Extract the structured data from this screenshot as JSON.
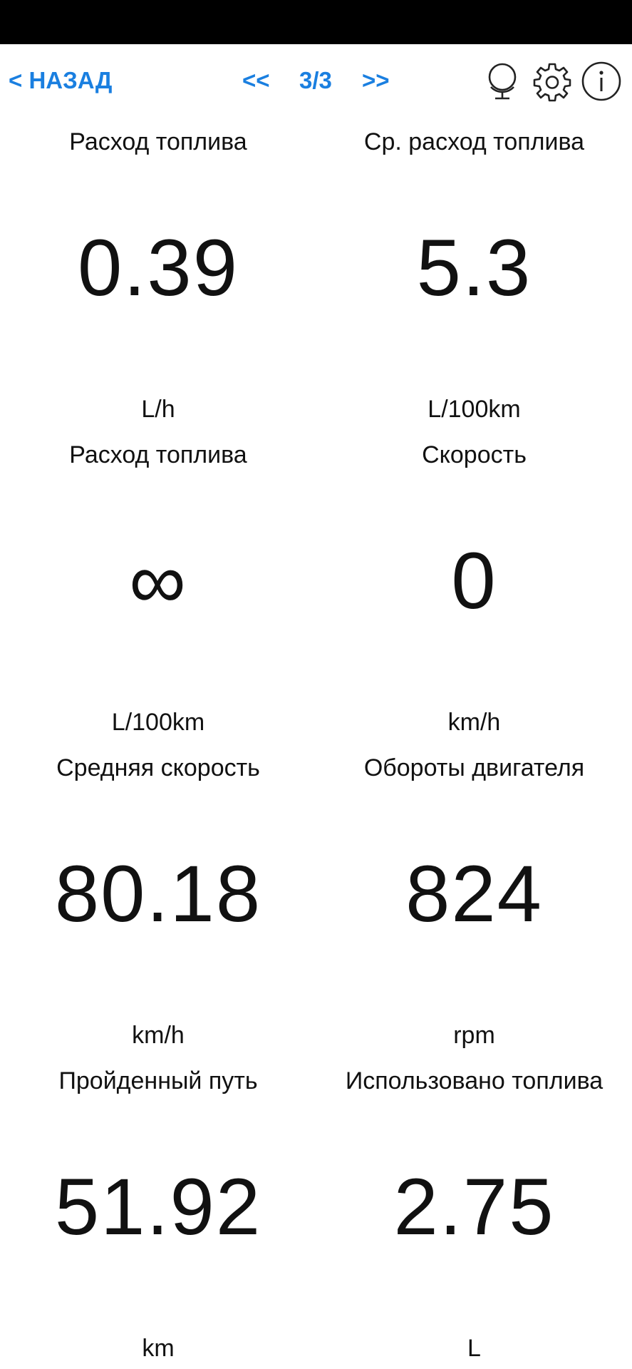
{
  "header": {
    "back_label": "< НАЗАД",
    "prev_label": "<<",
    "page_indicator": "3/3",
    "next_label": ">>",
    "icons": [
      "globe-icon",
      "gear-icon",
      "info-icon"
    ],
    "accent_color": "#1a7fe0"
  },
  "metrics": [
    {
      "label": "Расход топлива",
      "value": "0.39",
      "unit": "L/h"
    },
    {
      "label": "Ср. расход топлива",
      "value": "5.3",
      "unit": "L/100km"
    },
    {
      "label": "Расход топлива",
      "value": "∞",
      "unit": "L/100km"
    },
    {
      "label": "Скорость",
      "value": "0",
      "unit": "km/h"
    },
    {
      "label": "Средняя скорость",
      "value": "80.18",
      "unit": "km/h"
    },
    {
      "label": "Обороты двигателя",
      "value": "824",
      "unit": "rpm"
    },
    {
      "label": "Пройденный путь",
      "value": "51.92",
      "unit": "km"
    },
    {
      "label": "Использовано топлива",
      "value": "2.75",
      "unit": "L"
    }
  ]
}
